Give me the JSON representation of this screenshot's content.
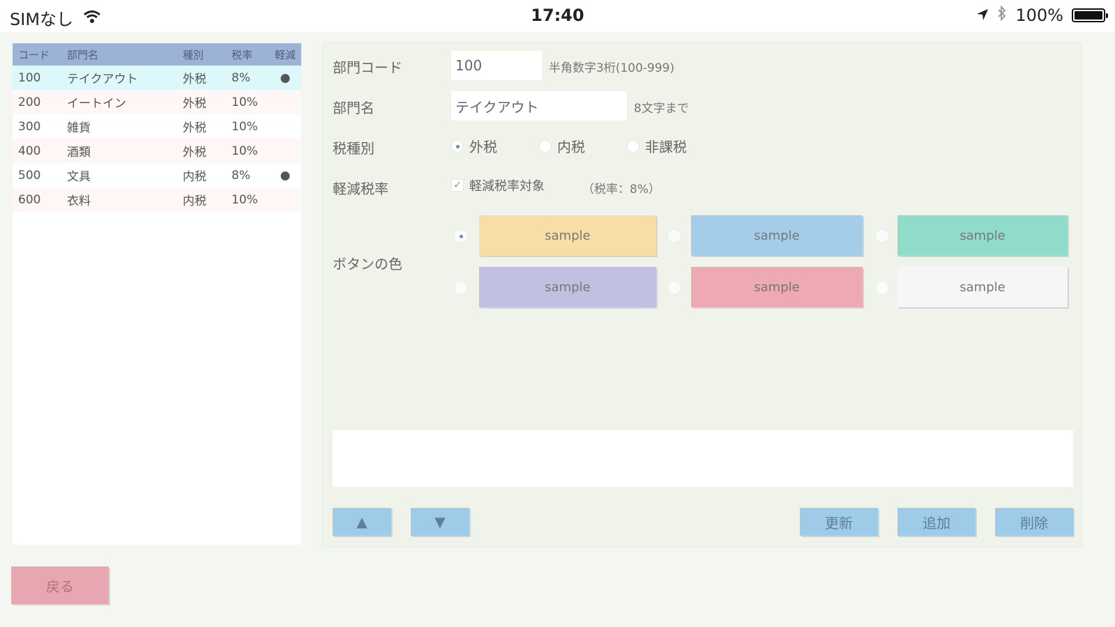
{
  "status_bar": {
    "carrier": "SIMなし",
    "time": "17:40",
    "battery": "100%",
    "battery_level": 1.0
  },
  "list": {
    "headers": [
      "コード",
      "部門名",
      "種別",
      "税率",
      "軽減"
    ],
    "rows": [
      {
        "code": "100",
        "name": "テイクアウト",
        "type": "外税",
        "rate": "8%",
        "reduced": "●"
      },
      {
        "code": "200",
        "name": "イートイン",
        "type": "外税",
        "rate": "10%",
        "reduced": ""
      },
      {
        "code": "300",
        "name": "雑貨",
        "type": "外税",
        "rate": "10%",
        "reduced": ""
      },
      {
        "code": "400",
        "name": "酒類",
        "type": "外税",
        "rate": "10%",
        "reduced": ""
      },
      {
        "code": "500",
        "name": "文具",
        "type": "内税",
        "rate": "8%",
        "reduced": "●"
      },
      {
        "code": "600",
        "name": "衣料",
        "type": "内税",
        "rate": "10%",
        "reduced": ""
      }
    ]
  },
  "form": {
    "code_label": "部門コード",
    "code_value": "100",
    "code_hint": "半角数字3桁(100-999)",
    "name_label": "部門名",
    "name_value": "テイクアウト",
    "name_hint": "8文字まで",
    "tax_type_label": "税種別",
    "tax_types": [
      "外税",
      "内税",
      "非課税"
    ],
    "tax_type_selected": "外税",
    "reduced_label": "軽減税率",
    "reduced_option": "軽減税率対象",
    "reduced_checked": true,
    "reduced_rate_note": "（税率：8%）",
    "color_label": "ボタンの色",
    "swatches": [
      {
        "label": "sample",
        "color": "#f7dea6",
        "selected": true
      },
      {
        "label": "sample",
        "color": "#a3cde9",
        "selected": false
      },
      {
        "label": "sample",
        "color": "#8fdccb",
        "selected": false
      },
      {
        "label": "sample",
        "color": "#c2c0e2",
        "selected": false
      },
      {
        "label": "sample",
        "color": "#eeaab3",
        "selected": false
      },
      {
        "label": "sample",
        "color": "#f6f6f6",
        "selected": false
      }
    ],
    "memo": ""
  },
  "buttons": {
    "up": "▲",
    "down": "▼",
    "update": "更新",
    "add": "追加",
    "delete": "削除",
    "back": "戻る"
  },
  "colors": {
    "header_bg": "#9db3d6",
    "selected_row": "#dcf8fb",
    "alt_row": "#fff6f6",
    "action_button": "#9dcbe8",
    "back_button": "#e8a7b0"
  }
}
